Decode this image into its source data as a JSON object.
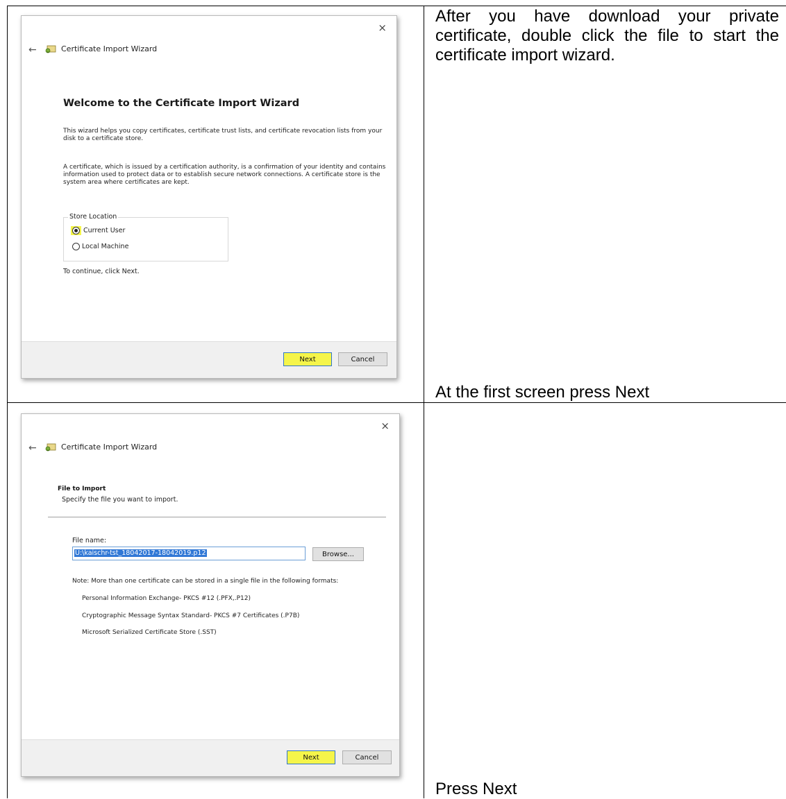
{
  "table": {
    "rows": [
      {
        "dialog": {
          "close_glyph": "×",
          "back_glyph": "←",
          "title": "Certificate Import Wizard",
          "heading": "Welcome to the Certificate Import Wizard",
          "paragraph1": "This wizard helps you copy certificates, certificate trust lists, and certificate revocation lists from your disk to a certificate store.",
          "paragraph2": "A certificate, which is issued by a certification authority, is a confirmation of your identity and contains information used to protect data or to establish secure network connections. A certificate store is the system area where certificates are kept.",
          "store_location": {
            "legend": "Store Location",
            "options": [
              {
                "label": "Current User",
                "selected": true
              },
              {
                "label": "Local Machine",
                "selected": false
              }
            ]
          },
          "continue_text": "To continue, click Next.",
          "next_label": "Next",
          "cancel_label": "Cancel"
        },
        "instruction_top": "After you have download your private certificate, double click the file to start the certificate import wizard.",
        "instruction_bottom": "At the first screen press Next"
      },
      {
        "dialog": {
          "close_glyph": "×",
          "back_glyph": "←",
          "title": "Certificate Import Wizard",
          "section_title": "File to Import",
          "section_subtitle": "Specify the file you want to import.",
          "file_name_label": "File name:",
          "file_name_value": "U:\\kaischr-tst_18042017-18042019.p12",
          "browse_label": "Browse...",
          "note": "Note:  More than one certificate can be stored in a single file in the following formats:",
          "formats": [
            "Personal Information Exchange- PKCS #12 (.PFX,.P12)",
            "Cryptographic Message Syntax Standard- PKCS #7 Certificates (.P7B)",
            "Microsoft Serialized Certificate Store (.SST)"
          ],
          "next_label": "Next",
          "cancel_label": "Cancel"
        },
        "instruction_bottom": "Press Next"
      }
    ]
  },
  "colors": {
    "highlight": "#f5f54a",
    "selection": "#3178d6",
    "footer_bg": "#f0f0f0"
  }
}
